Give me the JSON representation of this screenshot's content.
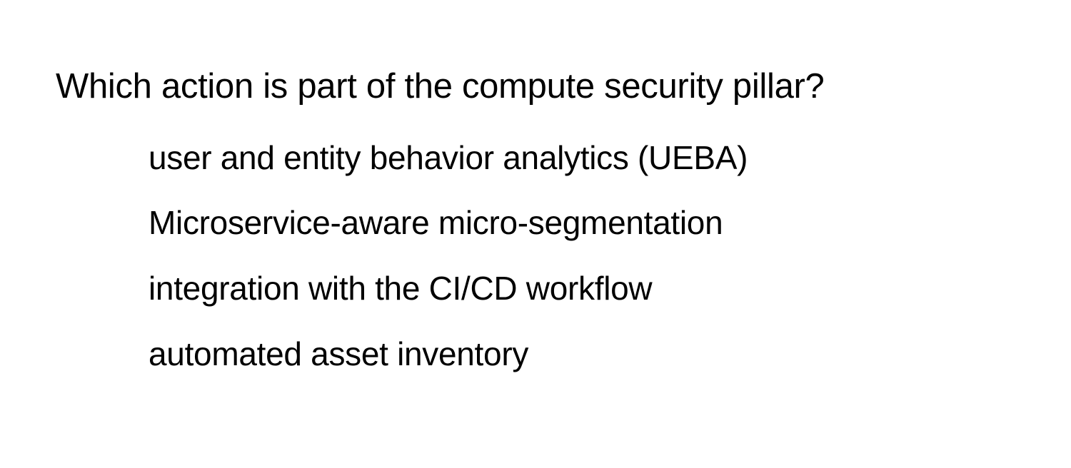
{
  "question": "Which action is part of the compute security pillar?",
  "options": [
    "user and entity behavior analytics (UEBA)",
    "Microservice-aware micro-segmentation",
    "integration with the CI/CD workflow",
    "automated asset inventory"
  ]
}
